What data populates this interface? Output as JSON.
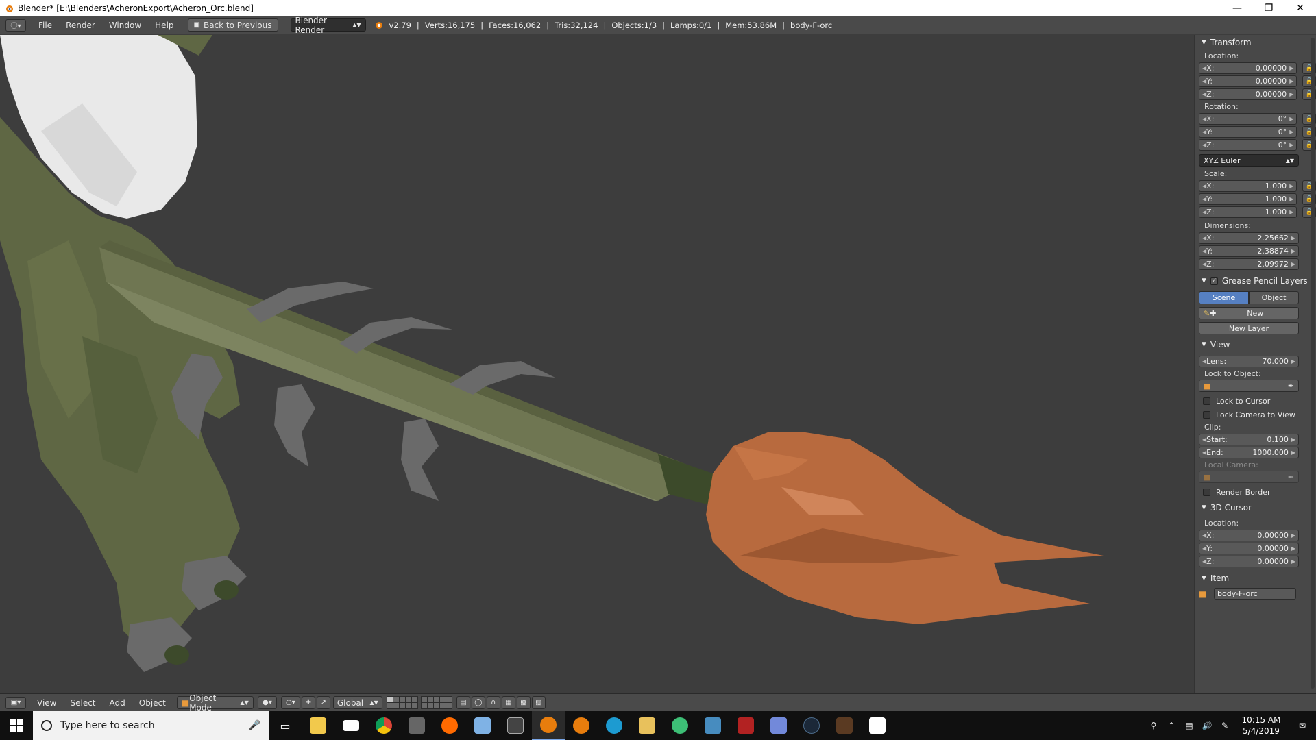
{
  "window": {
    "title": "Blender* [E:\\Blenders\\AcheronExport\\Acheron_Orc.blend]",
    "controls": [
      "minimize",
      "maximize",
      "close"
    ]
  },
  "info_header": {
    "menus": [
      "File",
      "Render",
      "Window",
      "Help"
    ],
    "back_button": "Back to Previous",
    "render_engine": "Blender Render",
    "stats": {
      "version": "v2.79",
      "verts": "Verts:16,175",
      "faces": "Faces:16,062",
      "tris": "Tris:32,124",
      "objects": "Objects:1/3",
      "lamps": "Lamps:0/1",
      "mem": "Mem:53.86M",
      "object_name": "body-F-orc"
    }
  },
  "properties": {
    "transform": {
      "title": "Transform",
      "location_label": "Location:",
      "location": [
        {
          "axis": "X:",
          "value": "0.00000"
        },
        {
          "axis": "Y:",
          "value": "0.00000"
        },
        {
          "axis": "Z:",
          "value": "0.00000"
        }
      ],
      "rotation_label": "Rotation:",
      "rotation": [
        {
          "axis": "X:",
          "value": "0°"
        },
        {
          "axis": "Y:",
          "value": "0°"
        },
        {
          "axis": "Z:",
          "value": "0°"
        }
      ],
      "rotation_mode": "XYZ Euler",
      "scale_label": "Scale:",
      "scale": [
        {
          "axis": "X:",
          "value": "1.000"
        },
        {
          "axis": "Y:",
          "value": "1.000"
        },
        {
          "axis": "Z:",
          "value": "1.000"
        }
      ],
      "dimensions_label": "Dimensions:",
      "dimensions": [
        {
          "axis": "X:",
          "value": "2.25662"
        },
        {
          "axis": "Y:",
          "value": "2.38874"
        },
        {
          "axis": "Z:",
          "value": "2.09972"
        }
      ]
    },
    "grease_pencil": {
      "title": "Grease Pencil Layers",
      "tab_scene": "Scene",
      "tab_object": "Object",
      "new_label": "New",
      "new_layer_label": "New Layer"
    },
    "view": {
      "title": "View",
      "lens_label": "Lens:",
      "lens_value": "70.000",
      "lock_object_label": "Lock to Object:",
      "lock_cursor": "Lock to Cursor",
      "lock_camera": "Lock Camera to View",
      "clip_label": "Clip:",
      "clip_start_label": "Start:",
      "clip_start": "0.100",
      "clip_end_label": "End:",
      "clip_end": "1000.000",
      "local_camera_label": "Local Camera:",
      "render_border": "Render Border"
    },
    "cursor": {
      "title": "3D Cursor",
      "location_label": "Location:",
      "location": [
        {
          "axis": "X:",
          "value": "0.00000"
        },
        {
          "axis": "Y:",
          "value": "0.00000"
        },
        {
          "axis": "Z:",
          "value": "0.00000"
        }
      ]
    },
    "item": {
      "title": "Item",
      "name": "body-F-orc"
    }
  },
  "view_header": {
    "menus": [
      "View",
      "Select",
      "Add",
      "Object"
    ],
    "mode": "Object Mode",
    "orientation": "Global"
  },
  "taskbar": {
    "search_placeholder": "Type here to search",
    "time": "10:15 AM",
    "date": "5/4/2019"
  },
  "colors": {
    "viewport_bg": "#3d3d3d",
    "orc_skin": "#5f6744",
    "shaft": "#6f7652",
    "claw": "#6a6a6a",
    "fur_tip": "#b86a3e",
    "accent_blue": "#5680c2"
  }
}
